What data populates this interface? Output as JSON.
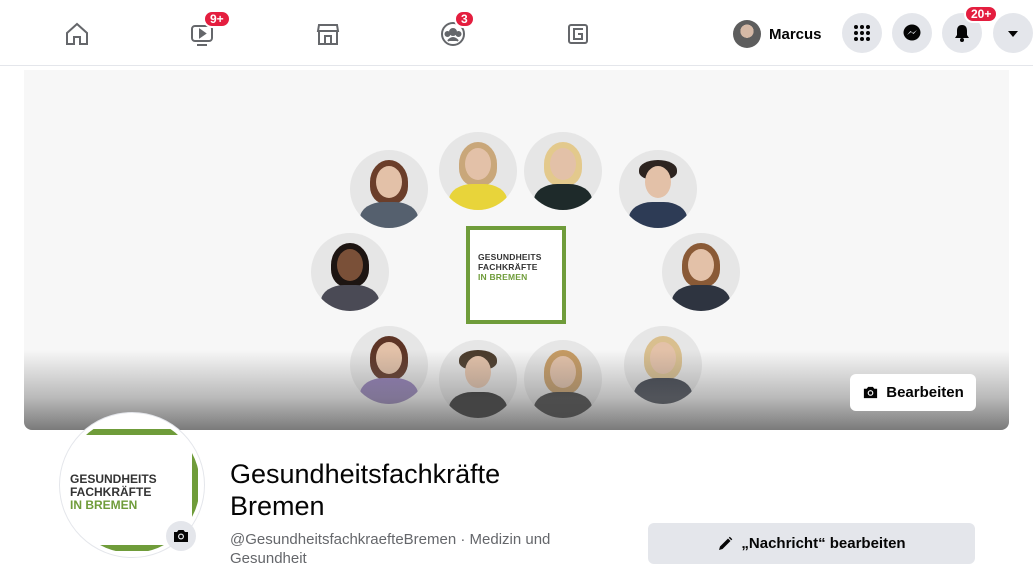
{
  "topbar": {
    "nav": [
      {
        "icon": "home-icon"
      },
      {
        "icon": "watch-icon",
        "badge": "9+"
      },
      {
        "icon": "marketplace-icon"
      },
      {
        "icon": "groups-icon",
        "badge": "3"
      },
      {
        "icon": "gaming-icon"
      }
    ],
    "profile_name": "Marcus",
    "notifications_badge": "20+"
  },
  "cover": {
    "logo_lines": [
      "GESUNDHEITS",
      "FACHKRÄFTE",
      "IN BREMEN"
    ],
    "edit_label": "Bearbeiten"
  },
  "profile": {
    "logo_lines": [
      "GESUNDHEITS",
      "FACHKRÄFTE",
      "IN BREMEN"
    ],
    "title": "Gesundheitsfachkräfte Bremen",
    "meta": "@GesundheitsfachkraefteBremen · Medizin und Gesundheit",
    "message_button": "„Nachricht“ bearbeiten"
  },
  "colors": {
    "accent_green": "#6f9c3a",
    "badge_red": "#e41e3f",
    "button_grey": "#e4e6eb"
  }
}
